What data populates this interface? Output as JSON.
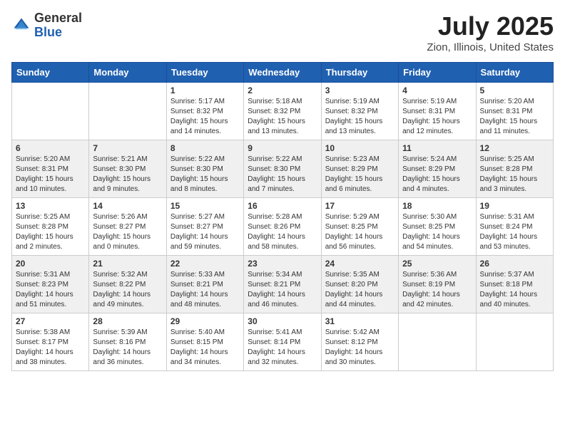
{
  "header": {
    "logo_line1": "General",
    "logo_line2": "Blue",
    "main_title": "July 2025",
    "sub_title": "Zion, Illinois, United States"
  },
  "days_of_week": [
    "Sunday",
    "Monday",
    "Tuesday",
    "Wednesday",
    "Thursday",
    "Friday",
    "Saturday"
  ],
  "weeks": [
    [
      {
        "day": "",
        "info": ""
      },
      {
        "day": "",
        "info": ""
      },
      {
        "day": "1",
        "info": "Sunrise: 5:17 AM\nSunset: 8:32 PM\nDaylight: 15 hours and 14 minutes."
      },
      {
        "day": "2",
        "info": "Sunrise: 5:18 AM\nSunset: 8:32 PM\nDaylight: 15 hours and 13 minutes."
      },
      {
        "day": "3",
        "info": "Sunrise: 5:19 AM\nSunset: 8:32 PM\nDaylight: 15 hours and 13 minutes."
      },
      {
        "day": "4",
        "info": "Sunrise: 5:19 AM\nSunset: 8:31 PM\nDaylight: 15 hours and 12 minutes."
      },
      {
        "day": "5",
        "info": "Sunrise: 5:20 AM\nSunset: 8:31 PM\nDaylight: 15 hours and 11 minutes."
      }
    ],
    [
      {
        "day": "6",
        "info": "Sunrise: 5:20 AM\nSunset: 8:31 PM\nDaylight: 15 hours and 10 minutes."
      },
      {
        "day": "7",
        "info": "Sunrise: 5:21 AM\nSunset: 8:30 PM\nDaylight: 15 hours and 9 minutes."
      },
      {
        "day": "8",
        "info": "Sunrise: 5:22 AM\nSunset: 8:30 PM\nDaylight: 15 hours and 8 minutes."
      },
      {
        "day": "9",
        "info": "Sunrise: 5:22 AM\nSunset: 8:30 PM\nDaylight: 15 hours and 7 minutes."
      },
      {
        "day": "10",
        "info": "Sunrise: 5:23 AM\nSunset: 8:29 PM\nDaylight: 15 hours and 6 minutes."
      },
      {
        "day": "11",
        "info": "Sunrise: 5:24 AM\nSunset: 8:29 PM\nDaylight: 15 hours and 4 minutes."
      },
      {
        "day": "12",
        "info": "Sunrise: 5:25 AM\nSunset: 8:28 PM\nDaylight: 15 hours and 3 minutes."
      }
    ],
    [
      {
        "day": "13",
        "info": "Sunrise: 5:25 AM\nSunset: 8:28 PM\nDaylight: 15 hours and 2 minutes."
      },
      {
        "day": "14",
        "info": "Sunrise: 5:26 AM\nSunset: 8:27 PM\nDaylight: 15 hours and 0 minutes."
      },
      {
        "day": "15",
        "info": "Sunrise: 5:27 AM\nSunset: 8:27 PM\nDaylight: 14 hours and 59 minutes."
      },
      {
        "day": "16",
        "info": "Sunrise: 5:28 AM\nSunset: 8:26 PM\nDaylight: 14 hours and 58 minutes."
      },
      {
        "day": "17",
        "info": "Sunrise: 5:29 AM\nSunset: 8:25 PM\nDaylight: 14 hours and 56 minutes."
      },
      {
        "day": "18",
        "info": "Sunrise: 5:30 AM\nSunset: 8:25 PM\nDaylight: 14 hours and 54 minutes."
      },
      {
        "day": "19",
        "info": "Sunrise: 5:31 AM\nSunset: 8:24 PM\nDaylight: 14 hours and 53 minutes."
      }
    ],
    [
      {
        "day": "20",
        "info": "Sunrise: 5:31 AM\nSunset: 8:23 PM\nDaylight: 14 hours and 51 minutes."
      },
      {
        "day": "21",
        "info": "Sunrise: 5:32 AM\nSunset: 8:22 PM\nDaylight: 14 hours and 49 minutes."
      },
      {
        "day": "22",
        "info": "Sunrise: 5:33 AM\nSunset: 8:21 PM\nDaylight: 14 hours and 48 minutes."
      },
      {
        "day": "23",
        "info": "Sunrise: 5:34 AM\nSunset: 8:21 PM\nDaylight: 14 hours and 46 minutes."
      },
      {
        "day": "24",
        "info": "Sunrise: 5:35 AM\nSunset: 8:20 PM\nDaylight: 14 hours and 44 minutes."
      },
      {
        "day": "25",
        "info": "Sunrise: 5:36 AM\nSunset: 8:19 PM\nDaylight: 14 hours and 42 minutes."
      },
      {
        "day": "26",
        "info": "Sunrise: 5:37 AM\nSunset: 8:18 PM\nDaylight: 14 hours and 40 minutes."
      }
    ],
    [
      {
        "day": "27",
        "info": "Sunrise: 5:38 AM\nSunset: 8:17 PM\nDaylight: 14 hours and 38 minutes."
      },
      {
        "day": "28",
        "info": "Sunrise: 5:39 AM\nSunset: 8:16 PM\nDaylight: 14 hours and 36 minutes."
      },
      {
        "day": "29",
        "info": "Sunrise: 5:40 AM\nSunset: 8:15 PM\nDaylight: 14 hours and 34 minutes."
      },
      {
        "day": "30",
        "info": "Sunrise: 5:41 AM\nSunset: 8:14 PM\nDaylight: 14 hours and 32 minutes."
      },
      {
        "day": "31",
        "info": "Sunrise: 5:42 AM\nSunset: 8:12 PM\nDaylight: 14 hours and 30 minutes."
      },
      {
        "day": "",
        "info": ""
      },
      {
        "day": "",
        "info": ""
      }
    ]
  ]
}
